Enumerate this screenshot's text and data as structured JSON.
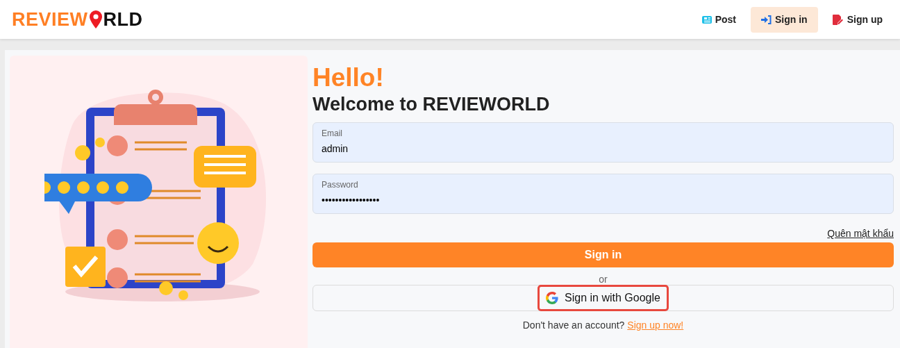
{
  "logo": {
    "part_1": "REVIEW",
    "part_2": "RLD"
  },
  "nav": [
    {
      "kind": "post",
      "label": "Post",
      "selected": false
    },
    {
      "kind": "signin",
      "label": "Sign in",
      "selected": true
    },
    {
      "kind": "signup",
      "label": "Sign up",
      "selected": false
    }
  ],
  "heading": "Hello!",
  "subheading": "Welcome to REVIEWORLD",
  "fields": [
    {
      "label": "Email",
      "value": "admin"
    },
    {
      "label": "Password",
      "value": "•••••••••••••••••"
    }
  ],
  "forgot_link": "Quên mật khẩu",
  "submit_button": "Sign in",
  "divider_text": "or",
  "google_button": {
    "label": "Sign in with Google",
    "highlighted": true
  },
  "signup_prompt": {
    "text": "Don't have an account?",
    "link": "Sign up now!"
  }
}
